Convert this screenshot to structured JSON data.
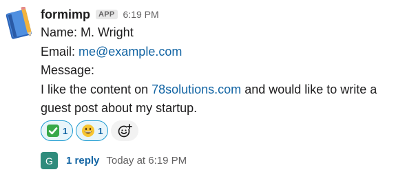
{
  "message": {
    "sender": "formimp",
    "badge": "APP",
    "time": "6:19 PM",
    "name_line": "Name: M. Wright",
    "email_label": "Email: ",
    "email_link": "me@example.com",
    "message_label": "Message:",
    "body_part1": "I like the content on ",
    "body_link": "78solutions.com",
    "body_part2": " and would like to write a",
    "body_line2": "guest post about my startup."
  },
  "reactions": [
    {
      "icon": "white-check-mark-icon",
      "count": "1",
      "color": "#2a9d3f"
    },
    {
      "icon": "grinning-face-icon",
      "count": "1",
      "color": "#f7c531"
    }
  ],
  "add_reaction_icon": "add-reaction-icon",
  "thread": {
    "avatar_letter": "G",
    "reply_count": "1 reply",
    "reply_time": "Today at 6:19 PM"
  },
  "colors": {
    "link": "#1264a3",
    "reaction_border": "#1d9bd1",
    "reaction_bg": "#e8f5fa",
    "thread_avatar": "#2f8c7c"
  }
}
